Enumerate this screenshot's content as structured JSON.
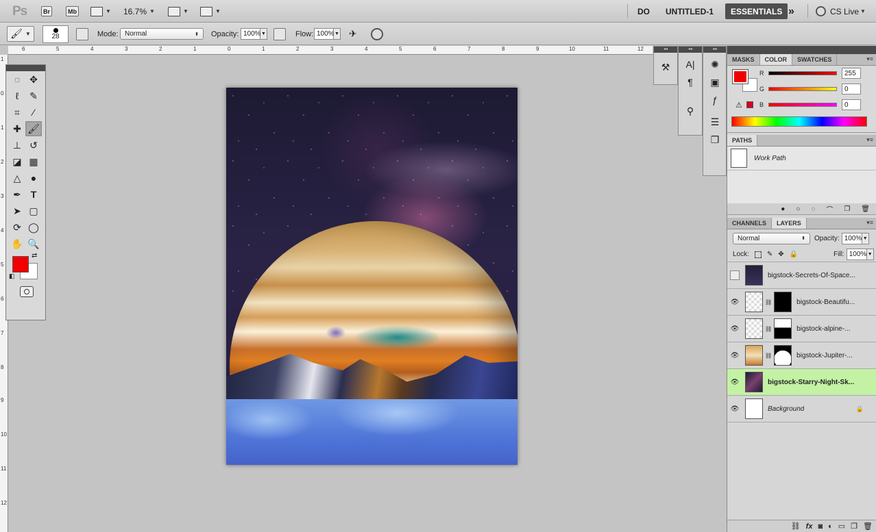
{
  "appbar": {
    "app_logo": "Ps",
    "bridge_label": "Br",
    "minibridge_label": "Mb",
    "zoom": "16.7%",
    "do_label": "DO",
    "document": "UNTITLED-1",
    "workspace": "ESSENTIALS",
    "more": "»",
    "cs_live": "CS Live"
  },
  "options": {
    "brush_size": "28",
    "mode_label": "Mode:",
    "mode_value": "Normal",
    "opacity_label": "Opacity:",
    "opacity_value": "100%",
    "flow_label": "Flow:",
    "flow_value": "100%"
  },
  "rulers": {
    "top": [
      "6",
      "5",
      "4",
      "3",
      "2",
      "1",
      "0",
      "1",
      "2",
      "3",
      "4",
      "5",
      "6",
      "7",
      "8",
      "9",
      "10",
      "11",
      "12"
    ],
    "left": [
      "1",
      "0",
      "1",
      "2",
      "3",
      "4",
      "5",
      "6",
      "7",
      "8",
      "9",
      "10",
      "11",
      "12",
      "13"
    ]
  },
  "color_panel": {
    "tabs": [
      "MASKS",
      "COLOR",
      "SWATCHES"
    ],
    "active_tab": "COLOR",
    "channels": [
      {
        "label": "R",
        "value": "255"
      },
      {
        "label": "G",
        "value": "0"
      },
      {
        "label": "B",
        "value": "0"
      }
    ],
    "foreground": "#f20000",
    "background": "#ffffff"
  },
  "paths_panel": {
    "title": "PATHS",
    "items": [
      "Work Path"
    ]
  },
  "layers_panel": {
    "tabs": [
      "CHANNELS",
      "LAYERS"
    ],
    "active_tab": "LAYERS",
    "blend_mode": "Normal",
    "opacity_label": "Opacity:",
    "opacity": "100%",
    "lock_label": "Lock:",
    "fill_label": "Fill:",
    "fill": "100%",
    "layers": [
      {
        "name": "bigstock-Secrets-Of-Space...",
        "visible": false,
        "mask": false,
        "selected": false
      },
      {
        "name": "bigstock-Beautifu...",
        "visible": true,
        "mask": true,
        "selected": false
      },
      {
        "name": "bigstock-alpine-...",
        "visible": true,
        "mask": true,
        "selected": false
      },
      {
        "name": "bigstock-Jupiter-...",
        "visible": true,
        "mask": true,
        "selected": false
      },
      {
        "name": "bigstock-Starry-Night-Sk...",
        "visible": true,
        "mask": false,
        "selected": true
      },
      {
        "name": "Background",
        "visible": true,
        "mask": false,
        "selected": false,
        "locked": true
      }
    ]
  },
  "colors": {
    "foreground": "#f20000",
    "selected_layer": "#c4f2a4",
    "essentials_bg": "#4f4f4f"
  }
}
